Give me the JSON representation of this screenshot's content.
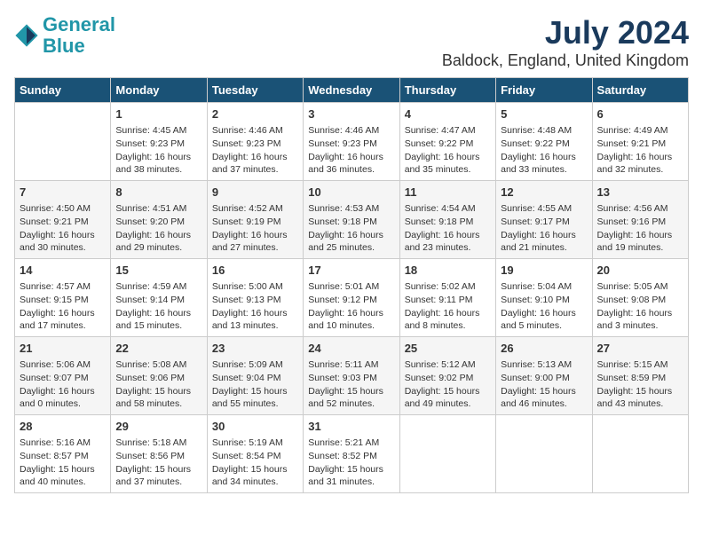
{
  "header": {
    "logo_line1": "General",
    "logo_line2": "Blue",
    "month_year": "July 2024",
    "location": "Baldock, England, United Kingdom"
  },
  "days_of_week": [
    "Sunday",
    "Monday",
    "Tuesday",
    "Wednesday",
    "Thursday",
    "Friday",
    "Saturday"
  ],
  "weeks": [
    [
      {
        "day": "",
        "info": ""
      },
      {
        "day": "1",
        "info": "Sunrise: 4:45 AM\nSunset: 9:23 PM\nDaylight: 16 hours\nand 38 minutes."
      },
      {
        "day": "2",
        "info": "Sunrise: 4:46 AM\nSunset: 9:23 PM\nDaylight: 16 hours\nand 37 minutes."
      },
      {
        "day": "3",
        "info": "Sunrise: 4:46 AM\nSunset: 9:23 PM\nDaylight: 16 hours\nand 36 minutes."
      },
      {
        "day": "4",
        "info": "Sunrise: 4:47 AM\nSunset: 9:22 PM\nDaylight: 16 hours\nand 35 minutes."
      },
      {
        "day": "5",
        "info": "Sunrise: 4:48 AM\nSunset: 9:22 PM\nDaylight: 16 hours\nand 33 minutes."
      },
      {
        "day": "6",
        "info": "Sunrise: 4:49 AM\nSunset: 9:21 PM\nDaylight: 16 hours\nand 32 minutes."
      }
    ],
    [
      {
        "day": "7",
        "info": "Sunrise: 4:50 AM\nSunset: 9:21 PM\nDaylight: 16 hours\nand 30 minutes."
      },
      {
        "day": "8",
        "info": "Sunrise: 4:51 AM\nSunset: 9:20 PM\nDaylight: 16 hours\nand 29 minutes."
      },
      {
        "day": "9",
        "info": "Sunrise: 4:52 AM\nSunset: 9:19 PM\nDaylight: 16 hours\nand 27 minutes."
      },
      {
        "day": "10",
        "info": "Sunrise: 4:53 AM\nSunset: 9:18 PM\nDaylight: 16 hours\nand 25 minutes."
      },
      {
        "day": "11",
        "info": "Sunrise: 4:54 AM\nSunset: 9:18 PM\nDaylight: 16 hours\nand 23 minutes."
      },
      {
        "day": "12",
        "info": "Sunrise: 4:55 AM\nSunset: 9:17 PM\nDaylight: 16 hours\nand 21 minutes."
      },
      {
        "day": "13",
        "info": "Sunrise: 4:56 AM\nSunset: 9:16 PM\nDaylight: 16 hours\nand 19 minutes."
      }
    ],
    [
      {
        "day": "14",
        "info": "Sunrise: 4:57 AM\nSunset: 9:15 PM\nDaylight: 16 hours\nand 17 minutes."
      },
      {
        "day": "15",
        "info": "Sunrise: 4:59 AM\nSunset: 9:14 PM\nDaylight: 16 hours\nand 15 minutes."
      },
      {
        "day": "16",
        "info": "Sunrise: 5:00 AM\nSunset: 9:13 PM\nDaylight: 16 hours\nand 13 minutes."
      },
      {
        "day": "17",
        "info": "Sunrise: 5:01 AM\nSunset: 9:12 PM\nDaylight: 16 hours\nand 10 minutes."
      },
      {
        "day": "18",
        "info": "Sunrise: 5:02 AM\nSunset: 9:11 PM\nDaylight: 16 hours\nand 8 minutes."
      },
      {
        "day": "19",
        "info": "Sunrise: 5:04 AM\nSunset: 9:10 PM\nDaylight: 16 hours\nand 5 minutes."
      },
      {
        "day": "20",
        "info": "Sunrise: 5:05 AM\nSunset: 9:08 PM\nDaylight: 16 hours\nand 3 minutes."
      }
    ],
    [
      {
        "day": "21",
        "info": "Sunrise: 5:06 AM\nSunset: 9:07 PM\nDaylight: 16 hours\nand 0 minutes."
      },
      {
        "day": "22",
        "info": "Sunrise: 5:08 AM\nSunset: 9:06 PM\nDaylight: 15 hours\nand 58 minutes."
      },
      {
        "day": "23",
        "info": "Sunrise: 5:09 AM\nSunset: 9:04 PM\nDaylight: 15 hours\nand 55 minutes."
      },
      {
        "day": "24",
        "info": "Sunrise: 5:11 AM\nSunset: 9:03 PM\nDaylight: 15 hours\nand 52 minutes."
      },
      {
        "day": "25",
        "info": "Sunrise: 5:12 AM\nSunset: 9:02 PM\nDaylight: 15 hours\nand 49 minutes."
      },
      {
        "day": "26",
        "info": "Sunrise: 5:13 AM\nSunset: 9:00 PM\nDaylight: 15 hours\nand 46 minutes."
      },
      {
        "day": "27",
        "info": "Sunrise: 5:15 AM\nSunset: 8:59 PM\nDaylight: 15 hours\nand 43 minutes."
      }
    ],
    [
      {
        "day": "28",
        "info": "Sunrise: 5:16 AM\nSunset: 8:57 PM\nDaylight: 15 hours\nand 40 minutes."
      },
      {
        "day": "29",
        "info": "Sunrise: 5:18 AM\nSunset: 8:56 PM\nDaylight: 15 hours\nand 37 minutes."
      },
      {
        "day": "30",
        "info": "Sunrise: 5:19 AM\nSunset: 8:54 PM\nDaylight: 15 hours\nand 34 minutes."
      },
      {
        "day": "31",
        "info": "Sunrise: 5:21 AM\nSunset: 8:52 PM\nDaylight: 15 hours\nand 31 minutes."
      },
      {
        "day": "",
        "info": ""
      },
      {
        "day": "",
        "info": ""
      },
      {
        "day": "",
        "info": ""
      }
    ]
  ]
}
